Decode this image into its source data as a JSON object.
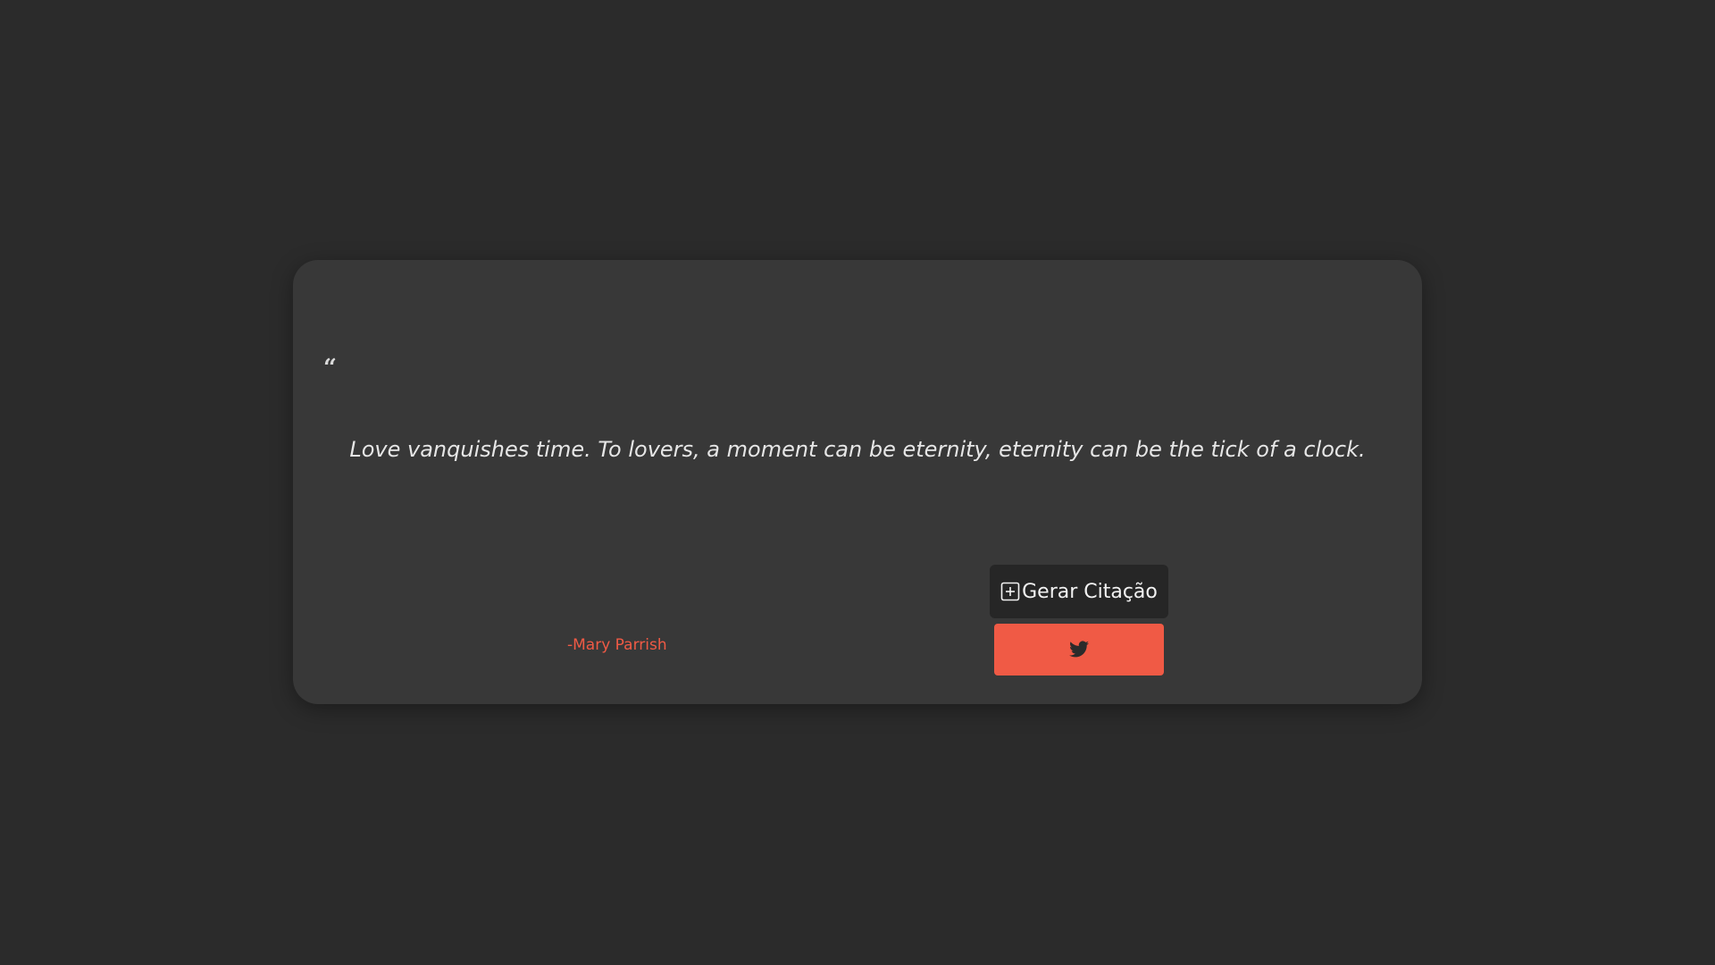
{
  "quote": {
    "open_mark": "“",
    "text": "Love vanquishes time. To lovers, a moment can be eternity, eternity can be the tick of a clock.",
    "author": "-Mary Parrish"
  },
  "actions": {
    "generate_label": "Gerar Citação",
    "generate_icon": "plus-square-icon",
    "tweet_icon": "twitter-icon"
  },
  "colors": {
    "background": "#2b2b2b",
    "card": "#383838",
    "accent": "#f05a45",
    "dark_button": "#262626"
  }
}
